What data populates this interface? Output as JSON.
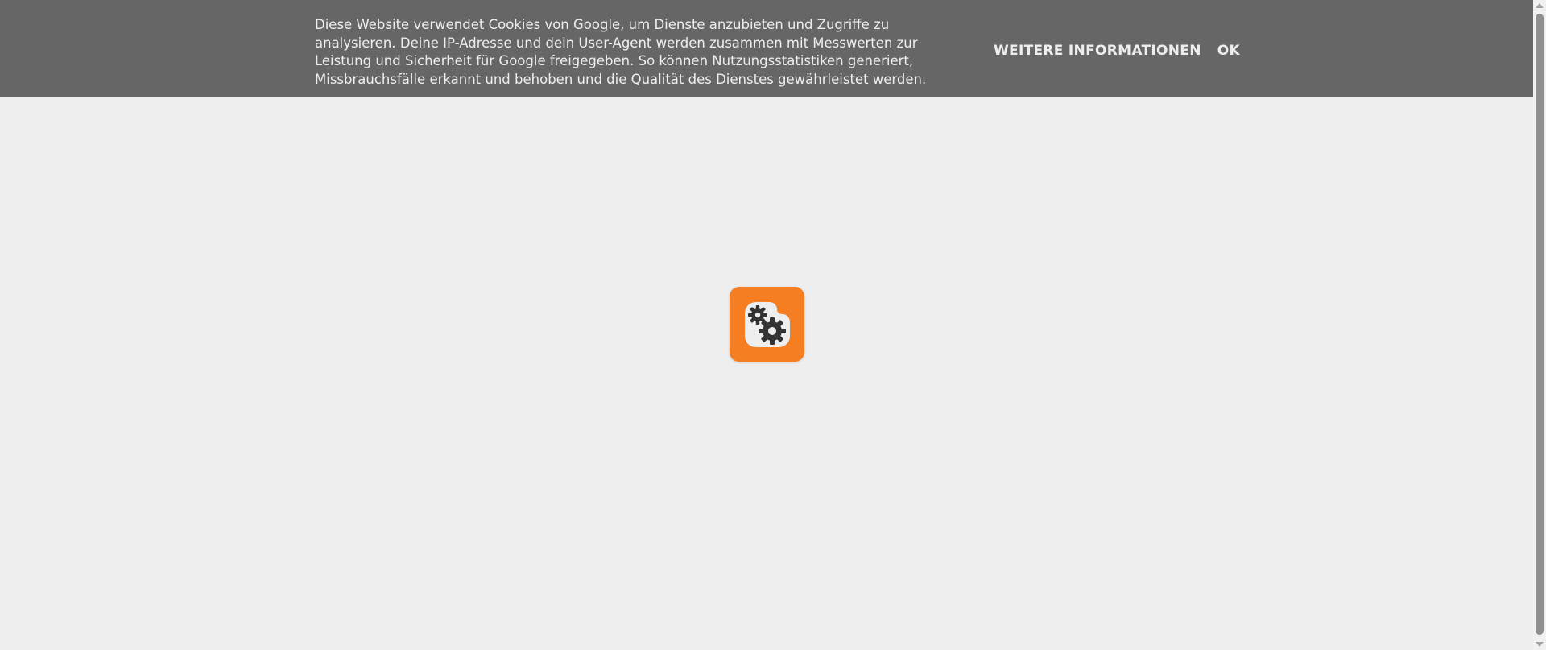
{
  "cookie_notice": {
    "text": "Diese Website verwendet Cookies von Google, um Dienste anzubieten und Zugriffe zu analysieren. Deine IP-Adresse und dein User-Agent werden zusammen mit Messwerten zur Leistung und Sicherheit für Google freigegeben. So können Nutzungsstatistiken generiert, Missbrauchsfälle erkannt und behoben und die Qualität des Dienstes gewährleistet werden.",
    "more_info_label": "WEITERE INFORMATIONEN",
    "ok_label": "OK"
  },
  "logo": {
    "icon": "blogger-gears-icon",
    "background_color": "#f57d22",
    "inner_color": "#eeeeee",
    "gear_color": "#333333"
  },
  "colors": {
    "page_background": "#eeeeee",
    "cookie_bar_background": "#666666",
    "cookie_bar_text": "#eeeeee"
  }
}
